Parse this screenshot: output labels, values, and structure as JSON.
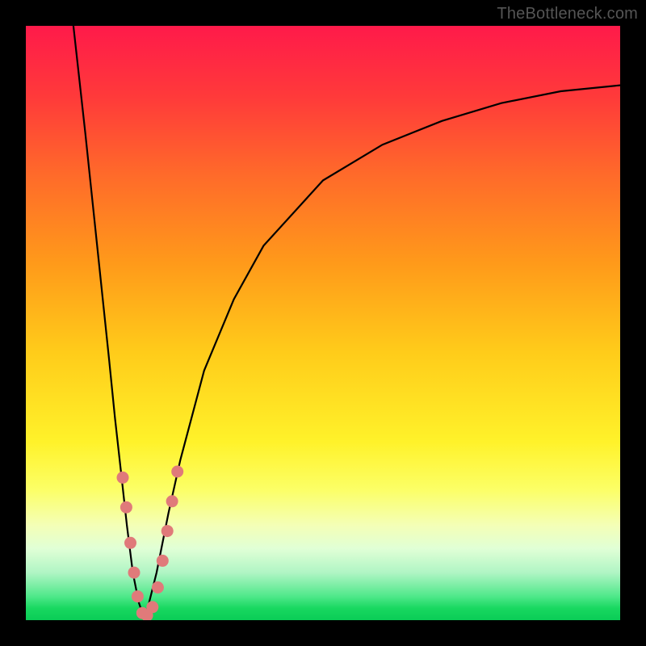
{
  "watermark": "TheBottleneck.com",
  "colors": {
    "frame": "#000000",
    "gradient_top": "#ff1a4a",
    "gradient_bottom": "#0acc56",
    "curve": "#000000",
    "beads": "#e07a7a"
  },
  "chart_data": {
    "type": "line",
    "title": "",
    "xlabel": "",
    "ylabel": "",
    "xlim": [
      0,
      100
    ],
    "ylim": [
      0,
      100
    ],
    "note": "No axes, ticks or numeric labels are visible. Values are estimated positions in percent of the plot area (x left→right, y bottom→top). Two branches form a V/check shape; small salmon beads sit near the valley on both branches.",
    "series": [
      {
        "name": "left-branch",
        "x": [
          8,
          10,
          12,
          14,
          15,
          16,
          17,
          18,
          19,
          20
        ],
        "values": [
          100,
          82,
          63,
          44,
          34,
          25,
          16,
          8,
          3,
          0
        ]
      },
      {
        "name": "right-branch",
        "x": [
          20,
          22,
          24,
          26,
          30,
          35,
          40,
          50,
          60,
          70,
          80,
          90,
          100
        ],
        "values": [
          0,
          8,
          18,
          27,
          42,
          54,
          63,
          74,
          80,
          84,
          87,
          89,
          90
        ]
      }
    ],
    "beads": [
      {
        "x": 16.3,
        "y": 24
      },
      {
        "x": 16.9,
        "y": 19
      },
      {
        "x": 17.6,
        "y": 13
      },
      {
        "x": 18.2,
        "y": 8
      },
      {
        "x": 18.8,
        "y": 4
      },
      {
        "x": 19.6,
        "y": 1.2
      },
      {
        "x": 20.4,
        "y": 0.8
      },
      {
        "x": 21.3,
        "y": 2.2
      },
      {
        "x": 22.2,
        "y": 5.5
      },
      {
        "x": 23.0,
        "y": 10
      },
      {
        "x": 23.8,
        "y": 15
      },
      {
        "x": 24.6,
        "y": 20
      },
      {
        "x": 25.5,
        "y": 25
      }
    ]
  }
}
